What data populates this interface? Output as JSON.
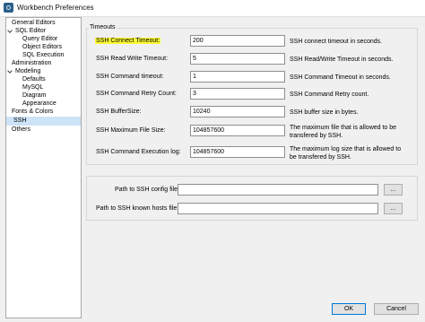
{
  "window": {
    "title": "Workbench Preferences"
  },
  "sidebar": {
    "items": [
      {
        "label": "General Editors"
      },
      {
        "label": "SQL Editor"
      },
      {
        "label": "Query Editor"
      },
      {
        "label": "Object Editors"
      },
      {
        "label": "SQL Execution"
      },
      {
        "label": "Administration"
      },
      {
        "label": "Modeling"
      },
      {
        "label": "Defaults"
      },
      {
        "label": "MySQL"
      },
      {
        "label": "Diagram"
      },
      {
        "label": "Appearance"
      },
      {
        "label": "Fonts & Colors"
      },
      {
        "label": "SSH"
      },
      {
        "label": "Others"
      }
    ],
    "selected": "SSH"
  },
  "timeouts": {
    "legend": "Timeouts",
    "fields": [
      {
        "label": "SSH Connect Timeout:",
        "value": "200",
        "description": "SSH connect timeout in seconds."
      },
      {
        "label": "SSH Read Write Timeout:",
        "value": "5",
        "description": "SSH Read/Write Timeout in seconds."
      },
      {
        "label": "SSH Command timeout:",
        "value": "1",
        "description": "SSH Command Timeout in seconds."
      },
      {
        "label": "SSH Command Retry Count:",
        "value": "3",
        "description": "SSH Command Retry count."
      },
      {
        "label": "SSH BufferSize:",
        "value": "10240",
        "description": "SSH buffer size in bytes."
      },
      {
        "label": "SSH Maximum File Size:",
        "value": "104857600",
        "description": "The maximum file that is allowed to be transfered by SSH."
      },
      {
        "label": "SSH Command Execution log:",
        "value": "104857600",
        "description": "The maximum log size that is allowed to be transfered by SSH."
      }
    ],
    "highlight_color": "#fbf835"
  },
  "paths": {
    "config": {
      "label": "Path to SSH config file:",
      "value": "",
      "browse": "..."
    },
    "known_hosts": {
      "label": "Path to SSH known hosts file:",
      "value": "",
      "browse": "..."
    }
  },
  "buttons": {
    "ok": "OK",
    "cancel": "Cancel"
  },
  "colors": {
    "selection": "#cde3f7",
    "ok_border": "#0078d7"
  }
}
